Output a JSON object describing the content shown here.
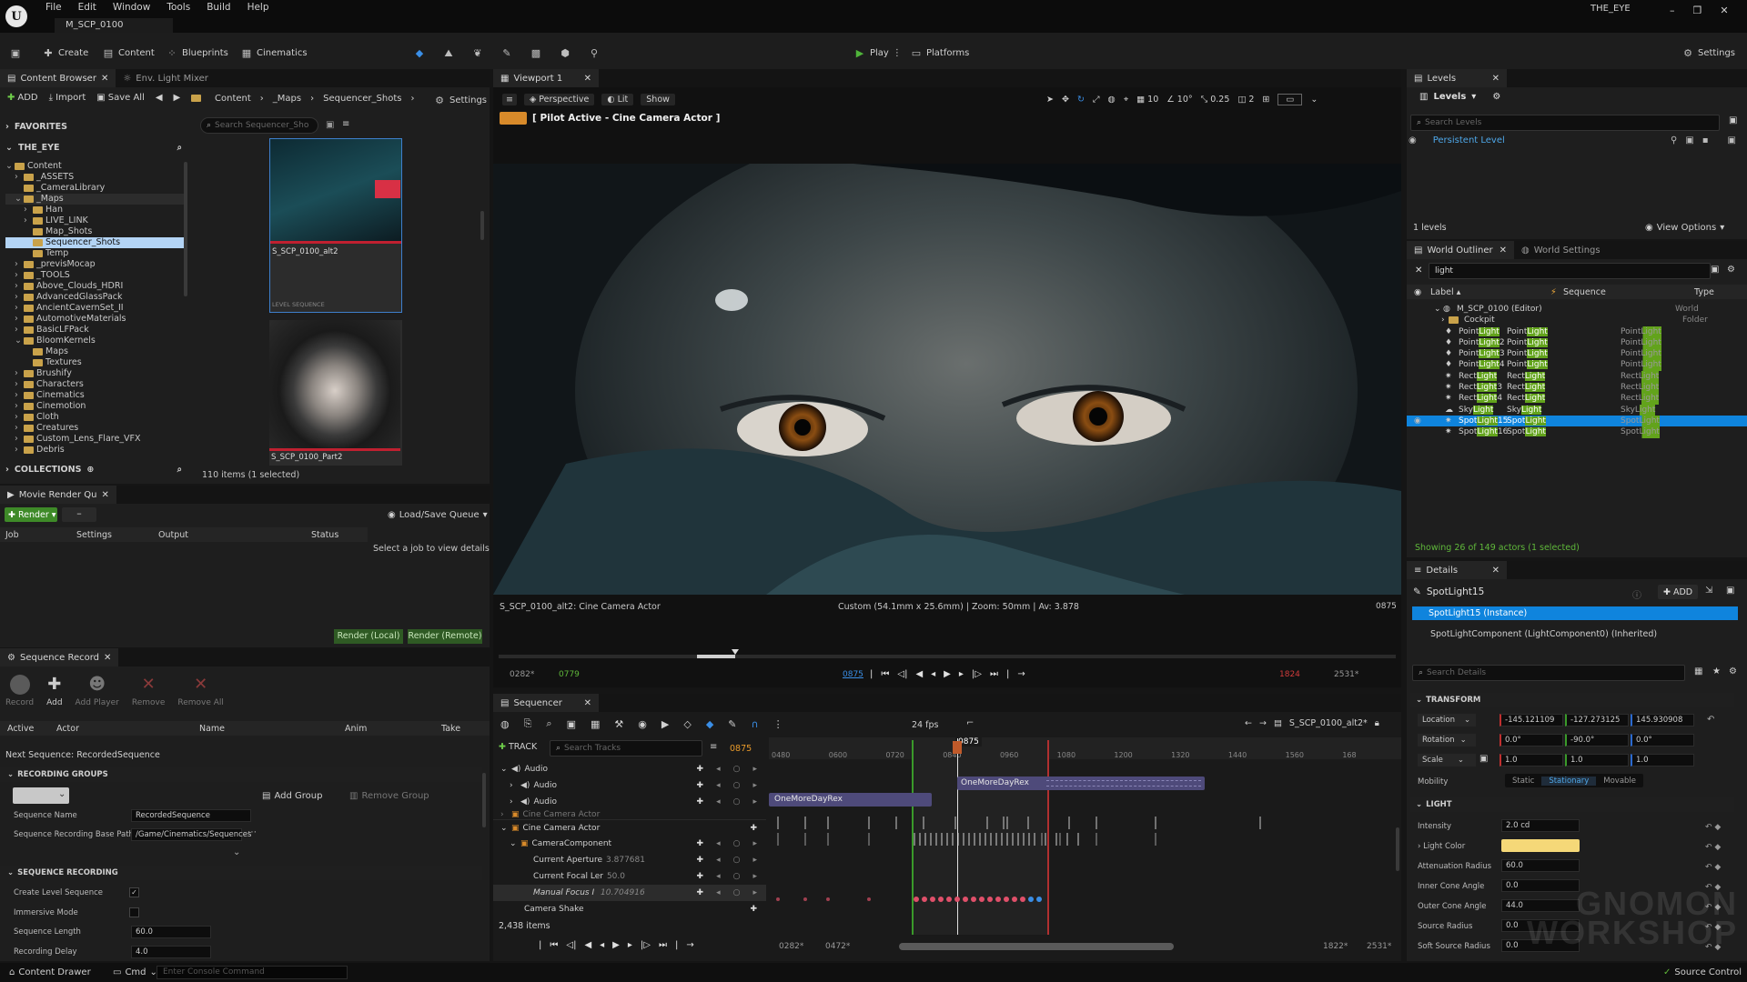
{
  "app": {
    "window_title": "THE_EYE",
    "map_tab": "M_SCP_0100"
  },
  "menu": [
    "File",
    "Edit",
    "Window",
    "Tools",
    "Build",
    "Help"
  ],
  "toolbar": {
    "create": "Create",
    "content": "Content",
    "blueprints": "Blueprints",
    "cinematics": "Cinematics",
    "play": "Play",
    "platforms": "Platforms",
    "settings": "Settings"
  },
  "content_browser": {
    "tab": "Content Browser",
    "tab2": "Env. Light Mixer",
    "add": "ADD",
    "import": "Import",
    "save_all": "Save All",
    "breadcrumb": [
      "Content",
      "_Maps",
      "Sequencer_Shots"
    ],
    "settings": "Settings",
    "favorites": "FAVORITES",
    "project": "THE_EYE",
    "search_placeholder": "Search Sequencer_Sho",
    "tree": [
      "Content",
      "_ASSETS",
      "_CameraLibrary",
      "_Maps",
      "Han",
      "LIVE_LINK",
      "Map_Shots",
      "Sequencer_Shots",
      "Temp",
      "_previsMocap",
      "_TOOLS",
      "Above_Clouds_HDRI",
      "AdvancedGlassPack",
      "AncientCavernSet_II",
      "AutomotiveMaterials",
      "BasicLFPack",
      "BloomKernels",
      "Maps",
      "Textures",
      "Brushify",
      "Characters",
      "Cinematics",
      "Cinemotion",
      "Cloth",
      "Creatures",
      "Custom_Lens_Flare_VFX",
      "Debris"
    ],
    "assets": [
      {
        "name": "S_SCP_0100_alt2",
        "type": "LEVEL SEQUENCE"
      },
      {
        "name": "S_SCP_0100_Part2",
        "type": ""
      }
    ],
    "collections": "COLLECTIONS",
    "count": "110 items (1 selected)"
  },
  "render_queue": {
    "tab": "Movie Render Qu",
    "render": "Render",
    "load_save": "Load/Save Queue",
    "cols": [
      "Job",
      "Settings",
      "Output",
      "Status"
    ],
    "empty": "Select a job to view details",
    "local": "Render (Local)",
    "remote": "Render (Remote)"
  },
  "seq_record": {
    "tab": "Sequence Record",
    "buttons": [
      "Record",
      "Add",
      "Add Player",
      "Remove",
      "Remove All"
    ],
    "cols": [
      "Active",
      "Actor",
      "Name",
      "Anim",
      "Take"
    ],
    "next": "Next Sequence: RecordedSequence",
    "groups_hdr": "RECORDING GROUPS",
    "add_group": "Add Group",
    "remove_group": "Remove Group",
    "seq_name_lbl": "Sequence Name",
    "seq_name": "RecordedSequence",
    "base_path_lbl": "Sequence Recording Base Path",
    "base_path": "/Game/Cinematics/Sequences",
    "recording_hdr": "SEQUENCE RECORDING",
    "create_level": "Create Level Sequence",
    "immersive": "Immersive Mode",
    "length_lbl": "Sequence Length",
    "length": "60.0",
    "delay_lbl": "Recording Delay",
    "delay": "4.0"
  },
  "viewport": {
    "tab": "Viewport 1",
    "perspective": "Perspective",
    "lit": "Lit",
    "show": "Show",
    "pilot": "[ Pilot Active - Cine Camera Actor ]",
    "grid": "10",
    "angle": "10°",
    "scale": "0.25",
    "cams": "2",
    "cam_label": "S_SCP_0100_alt2: Cine Camera Actor",
    "cam_info": "Custom (54.1mm x 25.6mm) | Zoom: 50mm | Av: 3.878",
    "frame": "0875",
    "range_start": "0282*",
    "in": "0779",
    "cur": "0875",
    "out": "1824",
    "range_end": "2531*"
  },
  "sequencer": {
    "tab": "Sequencer",
    "fps": "24 fps",
    "seq_name": "S_SCP_0100_alt2*",
    "track": "TRACK",
    "search": "Search Tracks",
    "frame": "0875",
    "ticks": [
      "0480",
      "0600",
      "0720",
      "0840",
      "0960",
      "1080",
      "1200",
      "1320",
      "1440",
      "1560",
      "168"
    ],
    "tracks": [
      {
        "name": "Audio",
        "indent": 0
      },
      {
        "name": "Audio",
        "indent": 1
      },
      {
        "name": "Audio",
        "indent": 1
      },
      {
        "name": "Cine Camera Actor",
        "indent": 0
      },
      {
        "name": "Cine Camera Actor",
        "indent": 0
      },
      {
        "name": "CameraComponent",
        "indent": 1
      },
      {
        "name": "Current Aperture",
        "indent": 2,
        "value": "3.877681"
      },
      {
        "name": "Current Focal Ler",
        "indent": 2,
        "value": "50.0"
      },
      {
        "name": "Manual Focus I",
        "indent": 2,
        "value": "10.704916"
      },
      {
        "name": "Camera Shake",
        "indent": 1
      }
    ],
    "clips": [
      "OneMoreDayRex",
      "OneMoreDayRex"
    ],
    "items": "2,438 items",
    "bottom": {
      "start": "0282*",
      "in": "0472*",
      "out": "1822*",
      "end": "2531*"
    }
  },
  "levels": {
    "tab": "Levels",
    "dropdown": "Levels",
    "search": "Search Levels",
    "persistent": "Persistent Level",
    "count": "1 levels",
    "view_options": "View Options"
  },
  "outliner": {
    "tab": "World Outliner",
    "tab2": "World Settings",
    "filter": "light",
    "cols": [
      "Label",
      "Sequence",
      "Type"
    ],
    "rows": [
      {
        "label": "M_SCP_0100 (Editor)",
        "seq": "",
        "type": "World"
      },
      {
        "label": "Cockpit",
        "seq": "",
        "type": "Folder"
      },
      {
        "label": "PointLight",
        "seq": "PointLight",
        "type": "PointLight"
      },
      {
        "label": "PointLight2",
        "seq": "PointLight",
        "type": "PointLight"
      },
      {
        "label": "PointLight3",
        "seq": "PointLight",
        "type": "PointLight"
      },
      {
        "label": "PointLight4",
        "seq": "PointLight",
        "type": "PointLight"
      },
      {
        "label": "RectLight",
        "seq": "RectLight",
        "type": "RectLight"
      },
      {
        "label": "RectLight3",
        "seq": "RectLight",
        "type": "RectLight"
      },
      {
        "label": "RectLight4",
        "seq": "RectLight",
        "type": "RectLight"
      },
      {
        "label": "SkyLight",
        "seq": "SkyLight",
        "type": "SkyLight"
      },
      {
        "label": "SpotLight15",
        "seq": "SpotLight",
        "type": "SpotLight"
      },
      {
        "label": "SpotLight16",
        "seq": "SpotLight",
        "type": "SpotLight"
      }
    ],
    "status": "Showing 26 of 149 actors (1 selected)"
  },
  "details": {
    "tab": "Details",
    "actor": "SpotLight15",
    "add": "ADD",
    "instance": "SpotLight15 (Instance)",
    "component": "SpotLightComponent (LightComponent0) (Inherited)",
    "search": "Search Details",
    "transform_hdr": "TRANSFORM",
    "location_lbl": "Location",
    "location": [
      "-145.121109",
      "-127.273125",
      "145.930908"
    ],
    "rotation_lbl": "Rotation",
    "rotation": [
      "0.0°",
      "-90.0°",
      "0.0°"
    ],
    "scale_lbl": "Scale",
    "scale": [
      "1.0",
      "1.0",
      "1.0"
    ],
    "mobility_lbl": "Mobility",
    "mobility": [
      "Static",
      "Stationary",
      "Movable"
    ],
    "light_hdr": "LIGHT",
    "intensity_lbl": "Intensity",
    "intensity": "2.0 cd",
    "color_lbl": "Light Color",
    "color": "#f5d878",
    "atten_lbl": "Attenuation Radius",
    "atten": "60.0",
    "inner_lbl": "Inner Cone Angle",
    "inner": "0.0",
    "outer_lbl": "Outer Cone Angle",
    "outer": "44.0",
    "srcr_lbl": "Source Radius",
    "srcr": "0.0",
    "soft_lbl": "Soft Source Radius",
    "soft": "0.0"
  },
  "statusbar": {
    "drawer": "Content Drawer",
    "cmd": "Cmd",
    "console": "Enter Console Command",
    "source": "Source Control"
  },
  "watermark": "GNOMON WORKSHOP",
  "colors": {
    "accent": "#1e90ff",
    "selected": "#0f84dd",
    "green": "#4f8b18",
    "highlight": "#62a31b"
  }
}
